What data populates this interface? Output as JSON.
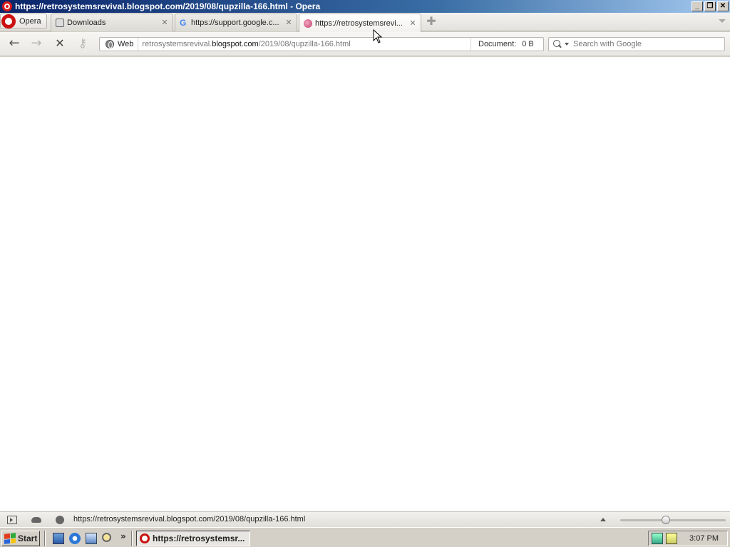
{
  "window": {
    "title": "https://retrosystemsrevival.blogspot.com/2019/08/qupzilla-166.html - Opera",
    "controls": {
      "minimize": "_",
      "restore": "❐",
      "close": "✕"
    }
  },
  "menu": {
    "label": "Opera"
  },
  "tabs": [
    {
      "label": "Downloads",
      "icon": "downloads-icon",
      "active": false
    },
    {
      "label": "https://support.google.c...",
      "icon": "google-icon",
      "active": false
    },
    {
      "label": "https://retrosystemsrevi...",
      "icon": "blog-icon",
      "active": true
    }
  ],
  "toolbar": {
    "back": "←",
    "forward": "→",
    "stop": "✕",
    "key": "⚷"
  },
  "address": {
    "badge": "Web",
    "url_prefix": "retrosystemsrevival.",
    "url_host": "blogspot.com",
    "url_path": "/2019/08/qupzilla-166.html",
    "doc_label": "Document:",
    "doc_value": "0 B"
  },
  "search": {
    "placeholder": "Search with Google"
  },
  "status": {
    "url": "https://retrosystemsrevival.blogspot.com/2019/08/qupzilla-166.html",
    "zoom_percent": 100
  },
  "taskbar": {
    "start": "Start",
    "more": "»",
    "task_label": "https://retrosystemsr...",
    "clock": "3:07 PM"
  }
}
